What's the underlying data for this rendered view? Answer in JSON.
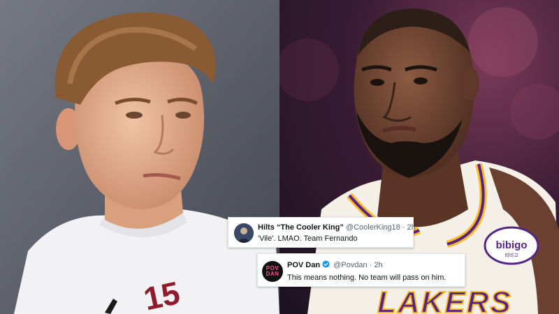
{
  "tweets": [
    {
      "display_name": "Hilts “The Cooler King”",
      "handle": "@CoolerKing18",
      "separator": "·",
      "time": "2h",
      "text": "'Vile'. LMAO.  Team Fernando",
      "verified": false,
      "avatar": "user-photo-avatar"
    },
    {
      "display_name": "POV Dan",
      "handle": "@Povdan",
      "separator": "·",
      "time": "2h",
      "text": "This means nothing. No team will pass on him.",
      "verified": true,
      "avatar_text": "POV\nDAN"
    }
  ],
  "photos": {
    "left": {
      "subject": "young-player-white-jersey",
      "jersey_number": "15"
    },
    "right": {
      "subject": "lakers-player-gold-jersey",
      "jersey_text": "LAKERS",
      "patch_text": "bibigo",
      "patch_subtext": "비비고"
    }
  },
  "colors": {
    "tweet_bg": "#ffffff",
    "name": "#0f1419",
    "meta": "#536471",
    "verified": "#1d9bf0",
    "lakers_gold": "#fdb927",
    "lakers_purple": "#552583"
  }
}
